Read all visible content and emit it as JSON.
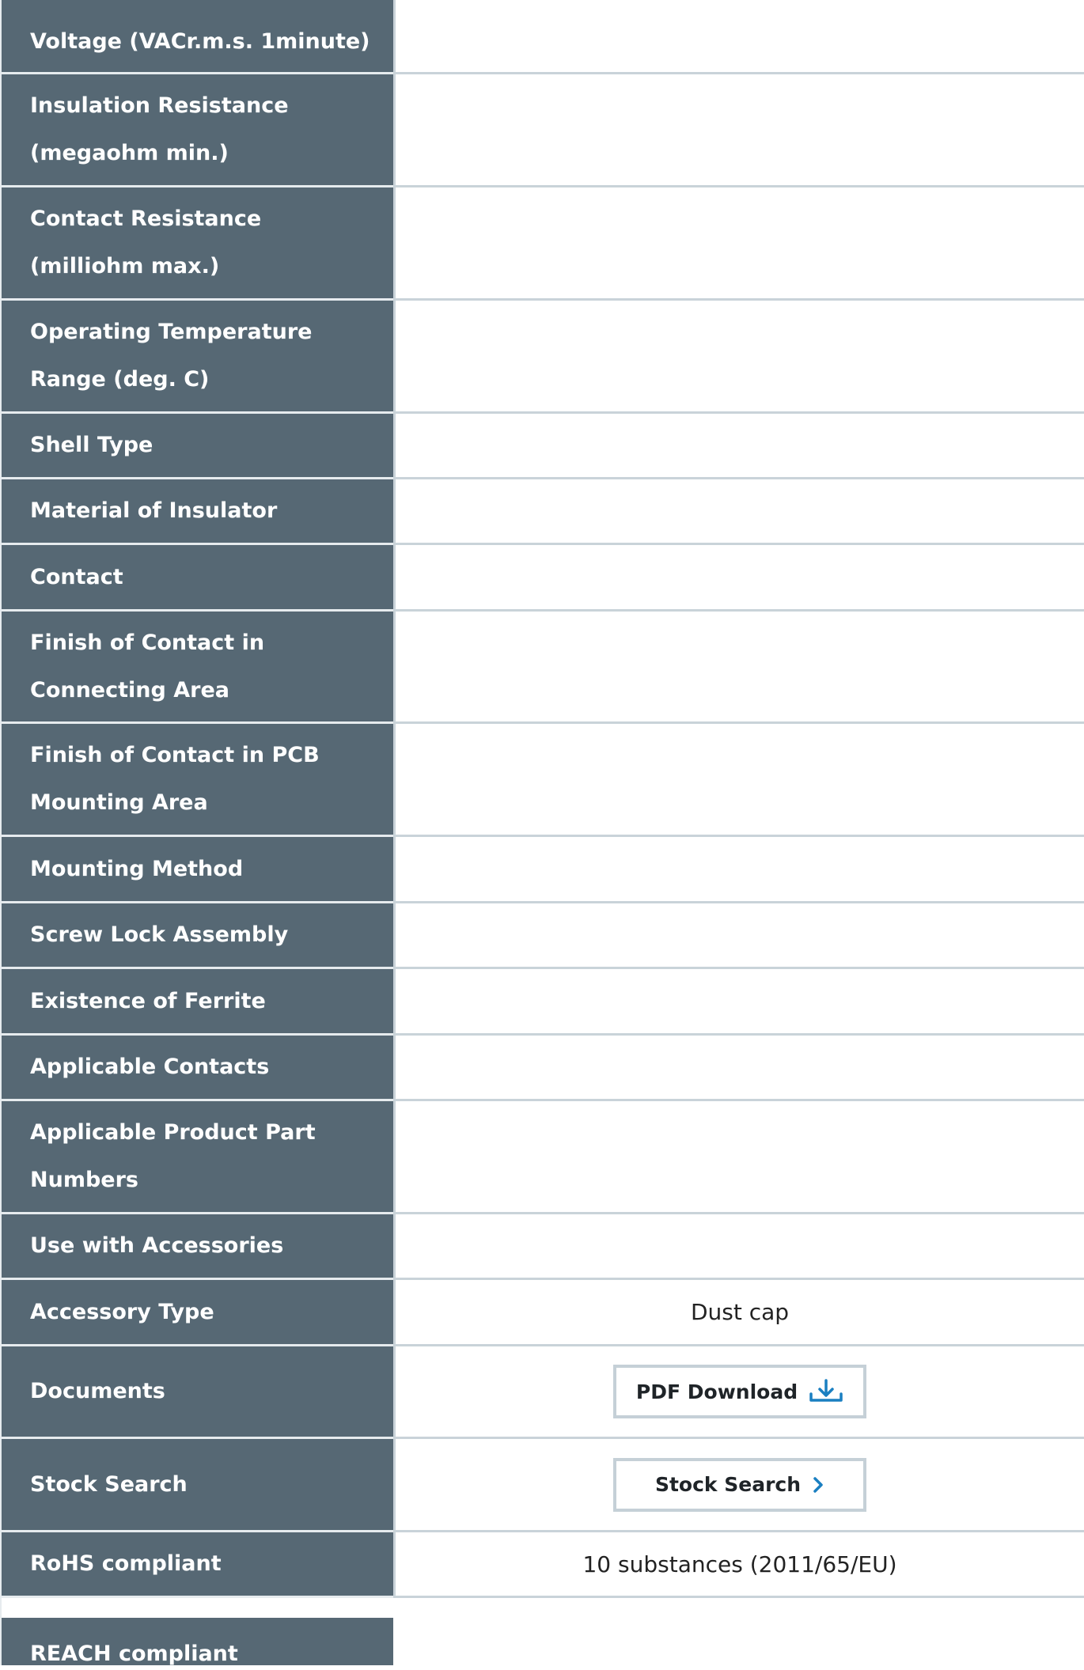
{
  "rows": [
    {
      "label": "Voltage (VACr.m.s. 1minute)",
      "value": ""
    },
    {
      "label": "Insulation Resistance (megaohm min.)",
      "value": ""
    },
    {
      "label": "Contact Resistance (milliohm max.)",
      "value": ""
    },
    {
      "label": "Operating Temperature Range (deg. C)",
      "value": ""
    },
    {
      "label": "Shell Type",
      "value": ""
    },
    {
      "label": "Material of Insulator",
      "value": ""
    },
    {
      "label": "Contact",
      "value": ""
    },
    {
      "label": "Finish of Contact in Connecting Area",
      "value": ""
    },
    {
      "label": "Finish of Contact in PCB Mounting Area",
      "value": ""
    },
    {
      "label": "Mounting Method",
      "value": ""
    },
    {
      "label": "Screw Lock Assembly",
      "value": ""
    },
    {
      "label": "Existence of Ferrite",
      "value": ""
    },
    {
      "label": "Applicable Contacts",
      "value": ""
    },
    {
      "label": "Applicable Product Part Numbers",
      "value": ""
    },
    {
      "label": "Use with Accessories",
      "value": ""
    },
    {
      "label": "Accessory Type",
      "value": "Dust cap"
    }
  ],
  "documents": {
    "label": "Documents",
    "button_label": "PDF Download",
    "icon": "download-icon"
  },
  "stock": {
    "label": "Stock Search",
    "button_label": "Stock Search",
    "icon": "chevron-right-icon"
  },
  "rohs": {
    "label": "RoHS compliant",
    "value": "10 substances (2011/65/EU)"
  },
  "reach": {
    "label": "REACH compliant"
  },
  "colors": {
    "label_bg": "#566874",
    "accent": "#1a7fc1",
    "border": "#c9d3d9"
  }
}
